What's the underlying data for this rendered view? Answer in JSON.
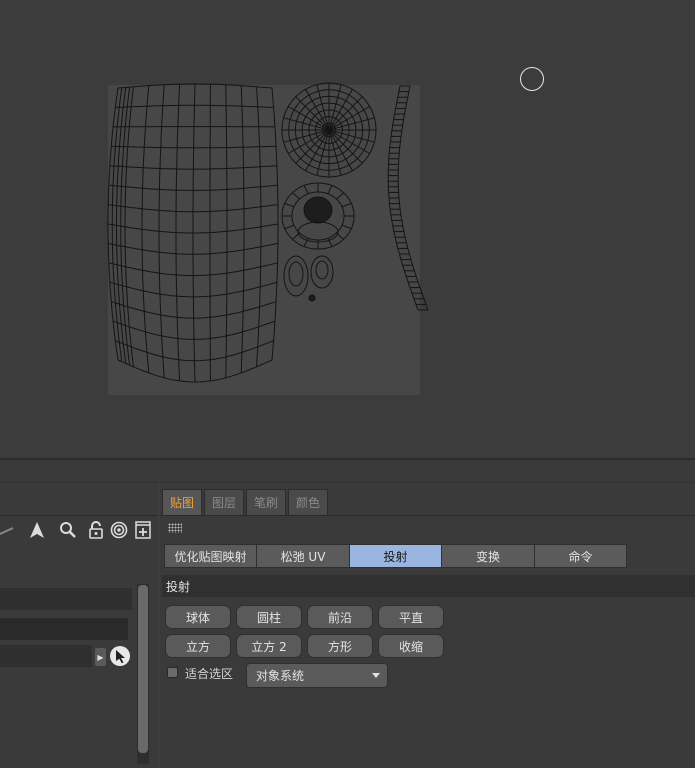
{
  "tabs": [
    {
      "label": "贴图",
      "active": true
    },
    {
      "label": "图层",
      "active": false
    },
    {
      "label": "笔刷",
      "active": false
    },
    {
      "label": "颜色",
      "active": false
    }
  ],
  "subtabs": [
    {
      "label": "优化贴图映射",
      "active": false
    },
    {
      "label": "松弛 UV",
      "active": false
    },
    {
      "label": "投射",
      "active": true
    },
    {
      "label": "变换",
      "active": false
    },
    {
      "label": "命令",
      "active": false
    }
  ],
  "section": {
    "title": "投射"
  },
  "projection_buttons": [
    [
      "球体",
      "圆柱",
      "前沿",
      "平直"
    ],
    [
      "立方",
      "立方 2",
      "方形",
      "收缩"
    ]
  ],
  "fit_selection": {
    "label": "适合选区",
    "checked": false
  },
  "coordinate_system": {
    "value": "对象系统"
  },
  "left_tools": [
    "plane-icon",
    "arrow-icon",
    "magnifier-icon",
    "lock-icon",
    "target-icon",
    "add-frame-icon"
  ],
  "colors": {
    "active_tab_text": "#f2a13c",
    "active_subtab_bg": "#9ab6e0",
    "uv_bg": "#4a4a4a",
    "wire": "#151515"
  }
}
